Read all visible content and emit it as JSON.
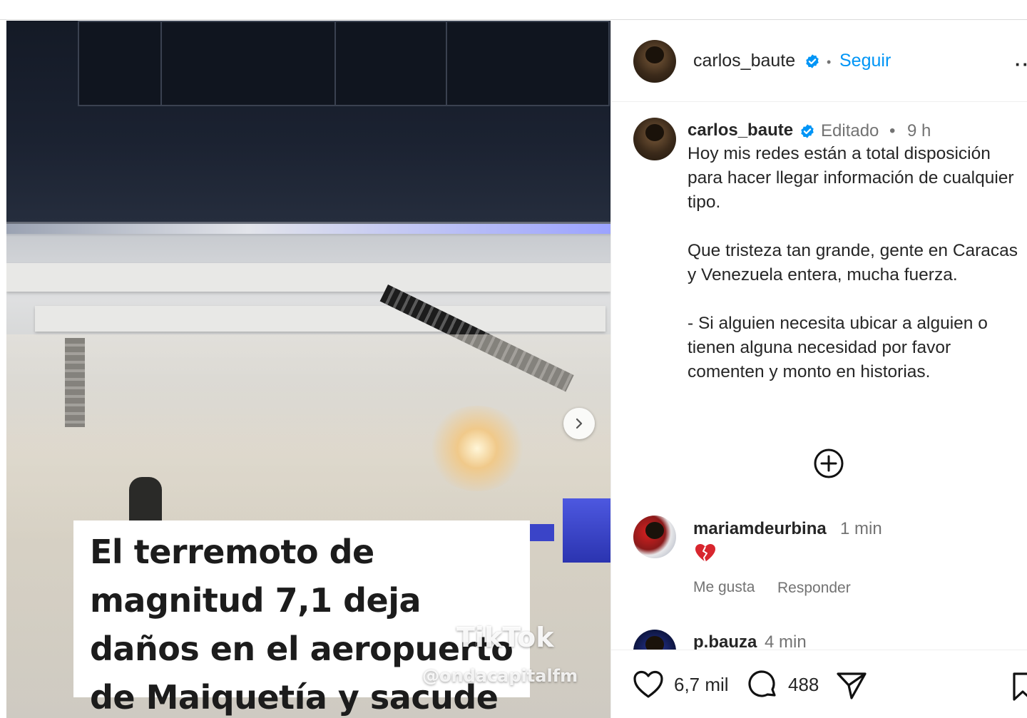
{
  "media": {
    "caption": "El terremoto de\nmagnitud 7,1 deja\ndaños en el aeropuerto\nde Maiquetía y sacude",
    "watermark": "TikTok",
    "watermark_handle": "@ondacapitalfm",
    "next_icon": "chevron-right-icon"
  },
  "header": {
    "username": "carlos_baute",
    "verified_icon": "verified-badge-icon",
    "separator": "•",
    "follow_label": "Seguir",
    "more_icon": "more-options-icon",
    "more_label": "··"
  },
  "post": {
    "username": "carlos_baute",
    "edited_label": "Editado",
    "separator": "•",
    "time": "9 h",
    "text": "Hoy mis redes están a total disposición para hacer llegar información de cualquier tipo.\n\nQue  tristeza tan grande, gente en Caracas y Venezuela entera, mucha fuerza.\n\n- Si alguien necesita ubicar a alguien o tienen alguna necesidad por favor comenten y monto en historias."
  },
  "add_comment_icon": "plus-circle-icon",
  "comments": [
    {
      "username": "mariamdeurbina",
      "time": "1 min",
      "content_icon": "broken-heart-emoji",
      "like_label": "Me gusta",
      "reply_label": "Responder"
    },
    {
      "username": "p.bauza",
      "time": "4 min"
    }
  ],
  "actions": {
    "like_icon": "heart-icon",
    "likes": "6,7 mil",
    "comment_icon": "comment-icon",
    "comments": "488",
    "share_icon": "send-icon",
    "save_icon": "bookmark-icon"
  },
  "colors": {
    "accent": "#0095f6",
    "text": "#262626",
    "secondary": "#737373",
    "verified": "#0095f6",
    "broken_heart": "#d8262e"
  }
}
